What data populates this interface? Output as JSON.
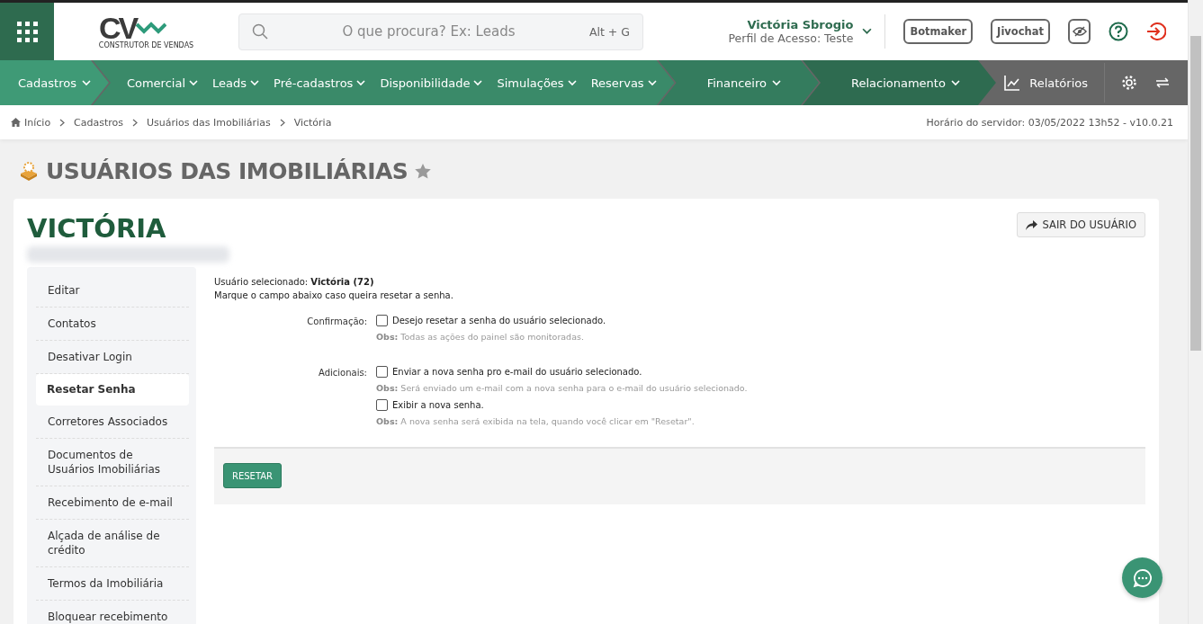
{
  "header": {
    "logo": {
      "letters": "CV",
      "tagline": "CONSTRUTOR DE VENDAS"
    },
    "search": {
      "placeholder": "O que procura? Ex: Leads",
      "shortcut": "Alt + G"
    },
    "user": {
      "name": "Victória Sbrogio",
      "profile": "Perfil de Acesso: Teste"
    },
    "buttons": [
      "Botmaker",
      "Jivochat"
    ]
  },
  "nav": {
    "groups": [
      {
        "color": "#3f9a76",
        "items": [
          "Cadastros"
        ]
      },
      {
        "color": "#3a8a69",
        "items": [
          "Comercial",
          "Leads",
          "Pré-cadastros",
          "Disponibilidade",
          "Simulações",
          "Reservas"
        ]
      },
      {
        "color": "#347c5e",
        "items": [
          "Financeiro"
        ]
      },
      {
        "color": "#2e6b50",
        "items": [
          "Relacionamento"
        ]
      }
    ],
    "reports": "Relatórios"
  },
  "breadcrumb": [
    "Início",
    "Cadastros",
    "Usuários das Imobiliárias",
    "Victória"
  ],
  "server_time": "Horário do servidor: 03/05/2022 13h52 - v10.0.21",
  "page_title": "USUÁRIOS DAS IMOBILIÁRIAS",
  "favorite": false,
  "user_title": "VICTÓRIA",
  "logout_button": "SAIR DO USUÁRIO",
  "sidebar": {
    "items": [
      {
        "label": "Editar",
        "selected": false
      },
      {
        "label": "Contatos",
        "selected": false
      },
      {
        "label": "Desativar Login",
        "selected": false
      },
      {
        "label": "Resetar Senha",
        "selected": true
      },
      {
        "label": "Corretores Associados",
        "selected": false
      },
      {
        "label": "Documentos de Usuários Imobiliárias",
        "selected": false
      },
      {
        "label": "Recebimento de e-mail",
        "selected": false
      },
      {
        "label": "Alçada de análise de crédito",
        "selected": false
      },
      {
        "label": "Termos da Imobiliária",
        "selected": false
      },
      {
        "label": "Bloquear recebimento",
        "selected": false
      }
    ]
  },
  "form": {
    "selected_user": "Usuário selecionado: **Victória (72)**",
    "instruction": "Marque o campo abaixo caso queira resetar a senha.",
    "groups": [
      {
        "label": "Confirmação:",
        "options": [
          {
            "text": "Desejo resetar a senha do usuário selecionado.",
            "checked": false,
            "note": "**Obs:** Todas as ações do painel são monitoradas."
          }
        ]
      },
      {
        "label": "Adicionais:",
        "options": [
          {
            "text": "Enviar a nova senha pro e-mail do usuário selecionado.",
            "checked": false,
            "note": "**Obs:** Será enviado um e-mail com a nova senha para o e-mail do usuário selecionado."
          },
          {
            "text": "Exibir a nova senha.",
            "checked": false,
            "note": "**Obs:** A nova senha será exibida na tela, quando você clicar em \"Resetar\"."
          }
        ]
      }
    ],
    "submit": "RESETAR"
  }
}
